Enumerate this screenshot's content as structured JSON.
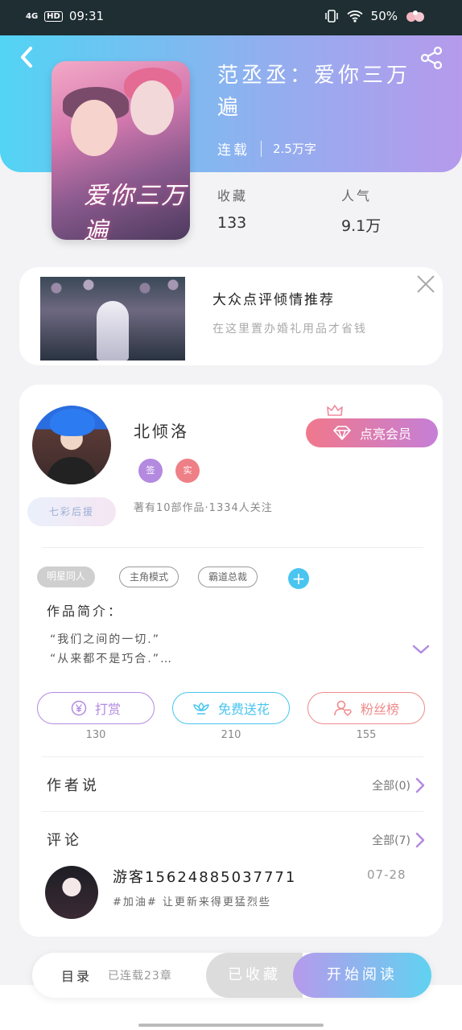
{
  "status_bar": {
    "network": "4G",
    "hd": "HD",
    "time": "09:31",
    "battery": "50%"
  },
  "book": {
    "title": "范丞丞：爱你三万遍",
    "status": "连载",
    "word_count": "2.5万字",
    "stats": [
      {
        "label": "收藏",
        "value": "133"
      },
      {
        "label": "人气",
        "value": "9.1万"
      }
    ],
    "cover_title": "爱你三万遍"
  },
  "ad": {
    "title": "大众点评倾情推荐",
    "subtitle": "在这里置办婚礼用品才省钱"
  },
  "author": {
    "name": "北倾洛",
    "badge_sign": "签",
    "badge_real": "实",
    "meta": "著有10部作品·1334人关注",
    "fan_badge": "七彩后援",
    "vip_button": "点亮会员"
  },
  "tags": [
    "明星同人",
    "主角模式",
    "霸道总裁"
  ],
  "intro": {
    "label": "作品简介：",
    "line1": "“我们之间的一切.”",
    "line2": "“从来都不是巧合.”…"
  },
  "actions": [
    {
      "label": "打赏",
      "count": "130",
      "color": "#b38ae0"
    },
    {
      "label": "免费送花",
      "count": "210",
      "color": "#49c5ef"
    },
    {
      "label": "粉丝榜",
      "count": "155",
      "color": "#ef8a8a"
    }
  ],
  "author_says": {
    "title": "作者说",
    "more": "全部(0)"
  },
  "comments": {
    "title": "评论",
    "more": "全部(7)",
    "items": [
      {
        "user": "游客15624885037771",
        "date": "07-28",
        "text": "#加油# 让更新来得更猛烈些"
      }
    ]
  },
  "bottom_bar": {
    "toc": "目录",
    "chapters": "已连载23章",
    "saved": "已收藏",
    "read": "开始阅读"
  },
  "colors": {
    "accent_cyan": "#49c5ef",
    "accent_purple": "#b69aec",
    "vip_pink": "#f0788c"
  }
}
